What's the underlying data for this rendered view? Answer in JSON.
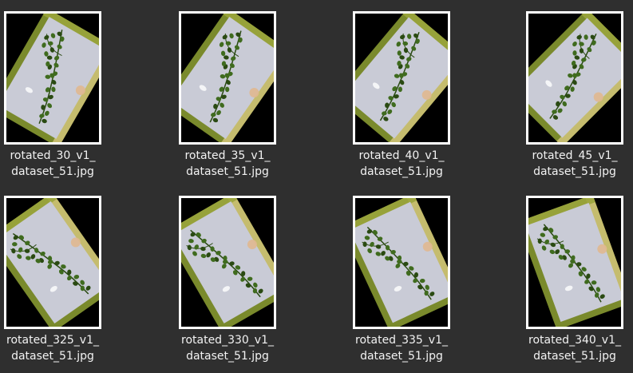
{
  "files": [
    {
      "name_line1": "rotated_30_v1_",
      "name_line2": "dataset_51.jpg",
      "angle": 30
    },
    {
      "name_line1": "rotated_35_v1_",
      "name_line2": "dataset_51.jpg",
      "angle": 35
    },
    {
      "name_line1": "rotated_40_v1_",
      "name_line2": "dataset_51.jpg",
      "angle": 40
    },
    {
      "name_line1": "rotated_45_v1_",
      "name_line2": "dataset_51.jpg",
      "angle": 45
    },
    {
      "name_line1": "rotated_325_v1_",
      "name_line2": "dataset_51.jpg",
      "angle": 325
    },
    {
      "name_line1": "rotated_330_v1_",
      "name_line2": "dataset_51.jpg",
      "angle": 330
    },
    {
      "name_line1": "rotated_335_v1_",
      "name_line2": "dataset_51.jpg",
      "angle": 335
    },
    {
      "name_line1": "rotated_340_v1_",
      "name_line2": "dataset_51.jpg",
      "angle": 340
    }
  ],
  "colors": {
    "background": "#2f2f2f",
    "thumb_border": "#ffffff",
    "label_text": "#f2f2f2",
    "paper": "#c9cbd6",
    "leaf": "#3f6b1e",
    "leaf_dark": "#2a4a12",
    "frame_green": "#7a8a2c",
    "frame_yellow": "#d8c880"
  }
}
